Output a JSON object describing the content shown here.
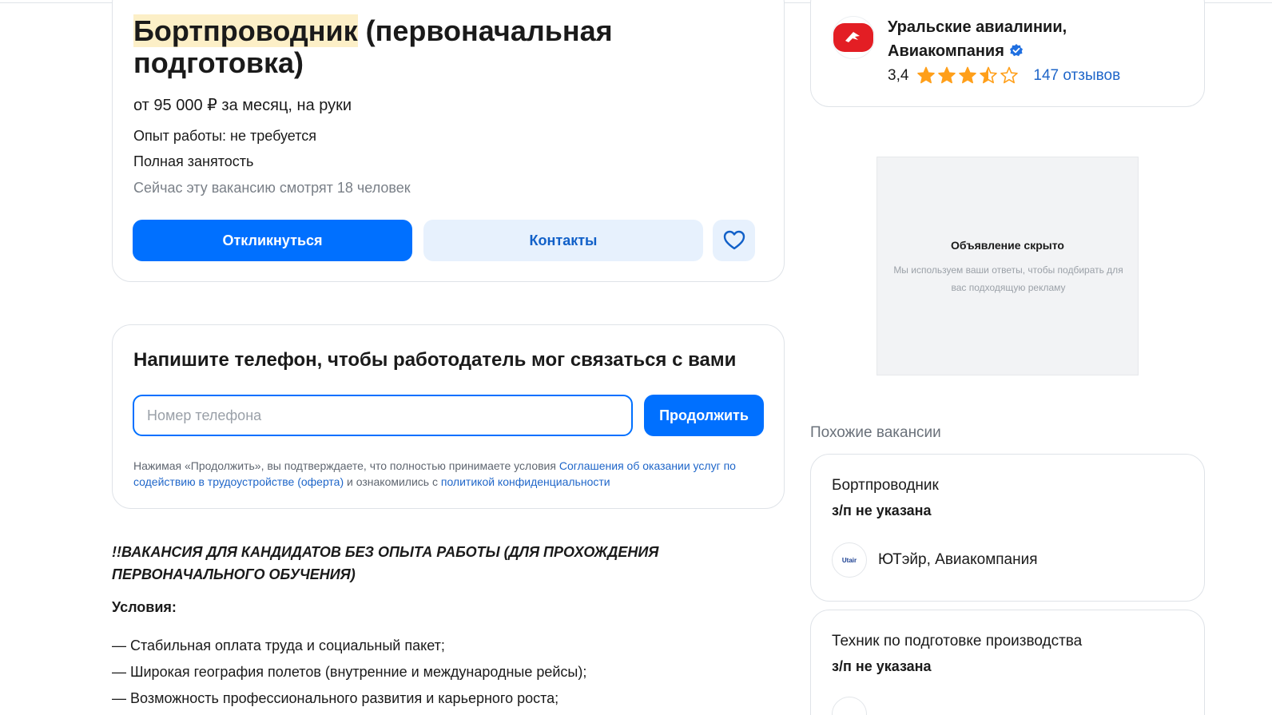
{
  "vacancy": {
    "title_highlight": "Бортпроводник",
    "title_rest": " (первоначальная подготовка)",
    "salary": "от 95 000 ₽ за месяц, на руки",
    "experience": "Опыт работы: не требуется",
    "employment": "Полная занятость",
    "viewers": "Сейчас эту вакансию смотрят 18 человек",
    "apply_label": "Откликнуться",
    "contacts_label": "Контакты"
  },
  "phone_form": {
    "title": "Напишите телефон, чтобы работодатель мог связаться с вами",
    "placeholder": "Номер телефона",
    "continue_label": "Продолжить",
    "legal_prefix": "Нажимая «Продолжить», вы подтверждаете, что полностью принимаете условия ",
    "legal_link1": "Соглашения об оказании услуг по содействию в трудоустройстве (оферта)",
    "legal_middle": " и ознакомились с ",
    "legal_link2": "политикой конфиденциальности"
  },
  "description": {
    "headline": "!!ВАКАНСИЯ ДЛЯ КАНДИДАТОВ БЕЗ ОПЫТА РАБОТЫ (ДЛЯ ПРОХОЖДЕНИЯ ПЕРВОНАЧАЛЬНОГО ОБУЧЕНИЯ)",
    "conditions_title": "Условия:",
    "conditions": [
      "— Стабильная оплата труда и социальный пакет;",
      "— Широкая география полетов (внутренние и международные рейсы);",
      "— Возможность профессионального развития и карьерного роста;"
    ]
  },
  "company": {
    "name": "Уральские авиалинии, Авиакомпания",
    "rating": "3,4",
    "rating_value": 3.4,
    "rating_max": 5,
    "reviews": "147 отзывов",
    "logo_color": "#e31e24"
  },
  "ad": {
    "title": "Объявление скрыто",
    "subtitle": "Мы используем ваши ответы, чтобы подбирать для вас подходящую рекламу"
  },
  "similar": {
    "title": "Похожие вакансии",
    "items": [
      {
        "title": "Бортпроводник",
        "salary": "з/п не указана",
        "company": "ЮТэйр, Авиакомпания",
        "logo_text": "Utair"
      },
      {
        "title": "Техник по подготовке производства",
        "salary": "з/п не указана"
      }
    ]
  },
  "colors": {
    "accent": "#0070ff",
    "link": "#1f66c9",
    "star": "#ff9f1a",
    "highlight": "#fcefc7"
  }
}
